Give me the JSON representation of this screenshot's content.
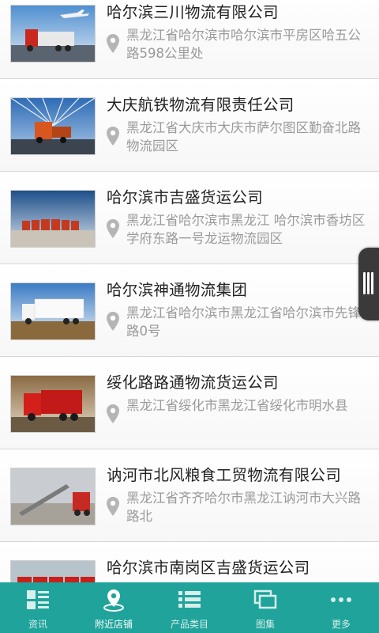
{
  "colors": {
    "accent": "#1fa39b",
    "title_text": "#222222",
    "address_text": "#9a9a9a",
    "handle": "#3a3a3a"
  },
  "companies": [
    {
      "name": "哈尔滨三川物流有限公司",
      "address": "黑龙江省哈尔滨市哈尔滨市平房区哈五公路598公里处",
      "image": "truck-with-airplane"
    },
    {
      "name": "大庆航铁物流有限责任公司",
      "address": "黑龙江省大庆市大庆市萨尔图区勤奋北路物流园区",
      "image": "truck-on-bridge"
    },
    {
      "name": "哈尔滨市吉盛货运公司",
      "address": "黑龙江省哈尔滨市黑龙江 哈尔滨市香坊区 学府东路一号龙运物流园区",
      "image": "truck-fleet"
    },
    {
      "name": "哈尔滨神通物流集团",
      "address": "黑龙江省哈尔滨市黑龙江省哈尔滨市先锋路0号",
      "image": "white-semi-truck"
    },
    {
      "name": "绥化路路通物流货运公司",
      "address": "黑龙江省绥化市黑龙江省绥化市明水县",
      "image": "red-cargo-truck"
    },
    {
      "name": "讷河市北风粮食工贸物流有限公司",
      "address": "黑龙江省齐齐哈尔市黑龙江讷河市大兴路路北",
      "image": "grain-loading-truck"
    },
    {
      "name": "哈尔滨市南岗区吉盛货运公司",
      "address": "",
      "image": "red-trucks-row"
    }
  ],
  "tabbar": {
    "tabs": [
      {
        "label": "资讯",
        "icon": "news-grid-icon",
        "active": false
      },
      {
        "label": "附近店铺",
        "icon": "location-pin-icon",
        "active": true
      },
      {
        "label": "产品类目",
        "icon": "category-list-icon",
        "active": false
      },
      {
        "label": "图集",
        "icon": "gallery-icon",
        "active": false
      },
      {
        "label": "更多",
        "icon": "more-dots-icon",
        "active": false
      }
    ]
  }
}
